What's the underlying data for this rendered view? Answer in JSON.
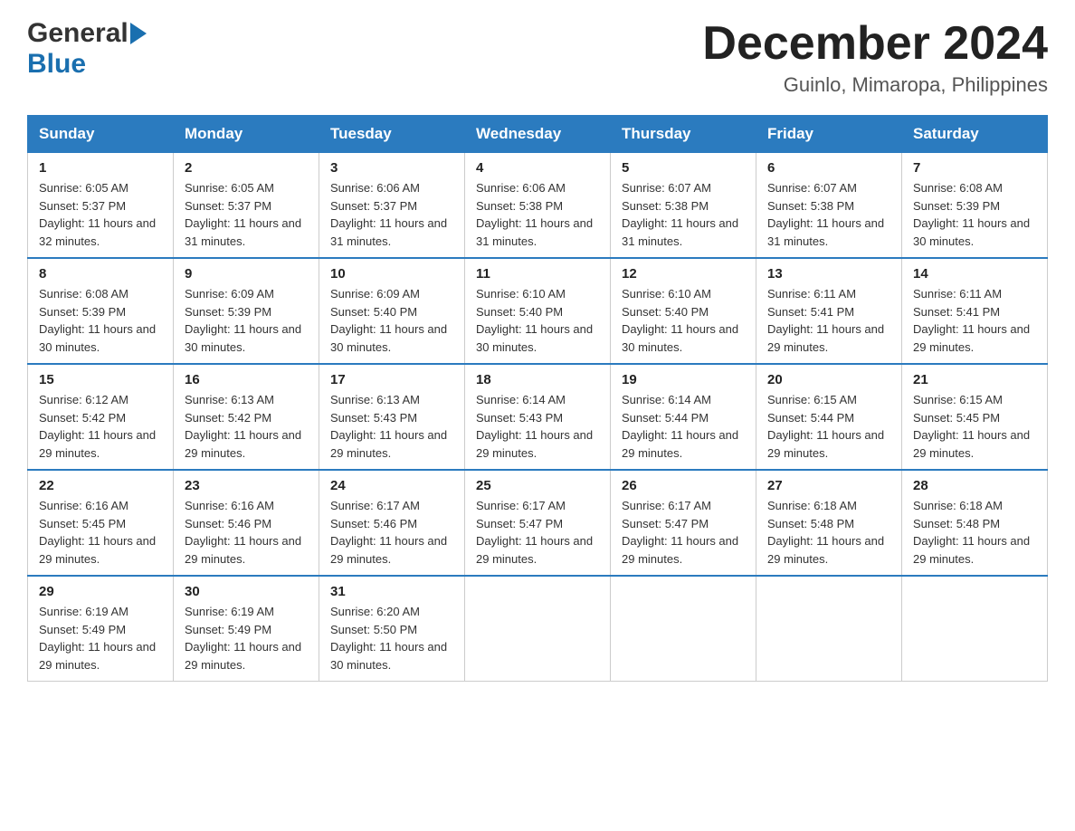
{
  "header": {
    "logo_general": "General",
    "logo_blue": "Blue",
    "month_title": "December 2024",
    "location": "Guinlo, Mimaropa, Philippines"
  },
  "days_of_week": [
    "Sunday",
    "Monday",
    "Tuesday",
    "Wednesday",
    "Thursday",
    "Friday",
    "Saturday"
  ],
  "weeks": [
    [
      {
        "day": "1",
        "sunrise": "6:05 AM",
        "sunset": "5:37 PM",
        "daylight": "11 hours and 32 minutes."
      },
      {
        "day": "2",
        "sunrise": "6:05 AM",
        "sunset": "5:37 PM",
        "daylight": "11 hours and 31 minutes."
      },
      {
        "day": "3",
        "sunrise": "6:06 AM",
        "sunset": "5:37 PM",
        "daylight": "11 hours and 31 minutes."
      },
      {
        "day": "4",
        "sunrise": "6:06 AM",
        "sunset": "5:38 PM",
        "daylight": "11 hours and 31 minutes."
      },
      {
        "day": "5",
        "sunrise": "6:07 AM",
        "sunset": "5:38 PM",
        "daylight": "11 hours and 31 minutes."
      },
      {
        "day": "6",
        "sunrise": "6:07 AM",
        "sunset": "5:38 PM",
        "daylight": "11 hours and 31 minutes."
      },
      {
        "day": "7",
        "sunrise": "6:08 AM",
        "sunset": "5:39 PM",
        "daylight": "11 hours and 30 minutes."
      }
    ],
    [
      {
        "day": "8",
        "sunrise": "6:08 AM",
        "sunset": "5:39 PM",
        "daylight": "11 hours and 30 minutes."
      },
      {
        "day": "9",
        "sunrise": "6:09 AM",
        "sunset": "5:39 PM",
        "daylight": "11 hours and 30 minutes."
      },
      {
        "day": "10",
        "sunrise": "6:09 AM",
        "sunset": "5:40 PM",
        "daylight": "11 hours and 30 minutes."
      },
      {
        "day": "11",
        "sunrise": "6:10 AM",
        "sunset": "5:40 PM",
        "daylight": "11 hours and 30 minutes."
      },
      {
        "day": "12",
        "sunrise": "6:10 AM",
        "sunset": "5:40 PM",
        "daylight": "11 hours and 30 minutes."
      },
      {
        "day": "13",
        "sunrise": "6:11 AM",
        "sunset": "5:41 PM",
        "daylight": "11 hours and 29 minutes."
      },
      {
        "day": "14",
        "sunrise": "6:11 AM",
        "sunset": "5:41 PM",
        "daylight": "11 hours and 29 minutes."
      }
    ],
    [
      {
        "day": "15",
        "sunrise": "6:12 AM",
        "sunset": "5:42 PM",
        "daylight": "11 hours and 29 minutes."
      },
      {
        "day": "16",
        "sunrise": "6:13 AM",
        "sunset": "5:42 PM",
        "daylight": "11 hours and 29 minutes."
      },
      {
        "day": "17",
        "sunrise": "6:13 AM",
        "sunset": "5:43 PM",
        "daylight": "11 hours and 29 minutes."
      },
      {
        "day": "18",
        "sunrise": "6:14 AM",
        "sunset": "5:43 PM",
        "daylight": "11 hours and 29 minutes."
      },
      {
        "day": "19",
        "sunrise": "6:14 AM",
        "sunset": "5:44 PM",
        "daylight": "11 hours and 29 minutes."
      },
      {
        "day": "20",
        "sunrise": "6:15 AM",
        "sunset": "5:44 PM",
        "daylight": "11 hours and 29 minutes."
      },
      {
        "day": "21",
        "sunrise": "6:15 AM",
        "sunset": "5:45 PM",
        "daylight": "11 hours and 29 minutes."
      }
    ],
    [
      {
        "day": "22",
        "sunrise": "6:16 AM",
        "sunset": "5:45 PM",
        "daylight": "11 hours and 29 minutes."
      },
      {
        "day": "23",
        "sunrise": "6:16 AM",
        "sunset": "5:46 PM",
        "daylight": "11 hours and 29 minutes."
      },
      {
        "day": "24",
        "sunrise": "6:17 AM",
        "sunset": "5:46 PM",
        "daylight": "11 hours and 29 minutes."
      },
      {
        "day": "25",
        "sunrise": "6:17 AM",
        "sunset": "5:47 PM",
        "daylight": "11 hours and 29 minutes."
      },
      {
        "day": "26",
        "sunrise": "6:17 AM",
        "sunset": "5:47 PM",
        "daylight": "11 hours and 29 minutes."
      },
      {
        "day": "27",
        "sunrise": "6:18 AM",
        "sunset": "5:48 PM",
        "daylight": "11 hours and 29 minutes."
      },
      {
        "day": "28",
        "sunrise": "6:18 AM",
        "sunset": "5:48 PM",
        "daylight": "11 hours and 29 minutes."
      }
    ],
    [
      {
        "day": "29",
        "sunrise": "6:19 AM",
        "sunset": "5:49 PM",
        "daylight": "11 hours and 29 minutes."
      },
      {
        "day": "30",
        "sunrise": "6:19 AM",
        "sunset": "5:49 PM",
        "daylight": "11 hours and 29 minutes."
      },
      {
        "day": "31",
        "sunrise": "6:20 AM",
        "sunset": "5:50 PM",
        "daylight": "11 hours and 30 minutes."
      },
      null,
      null,
      null,
      null
    ]
  ],
  "labels": {
    "sunrise": "Sunrise:",
    "sunset": "Sunset:",
    "daylight": "Daylight:"
  }
}
